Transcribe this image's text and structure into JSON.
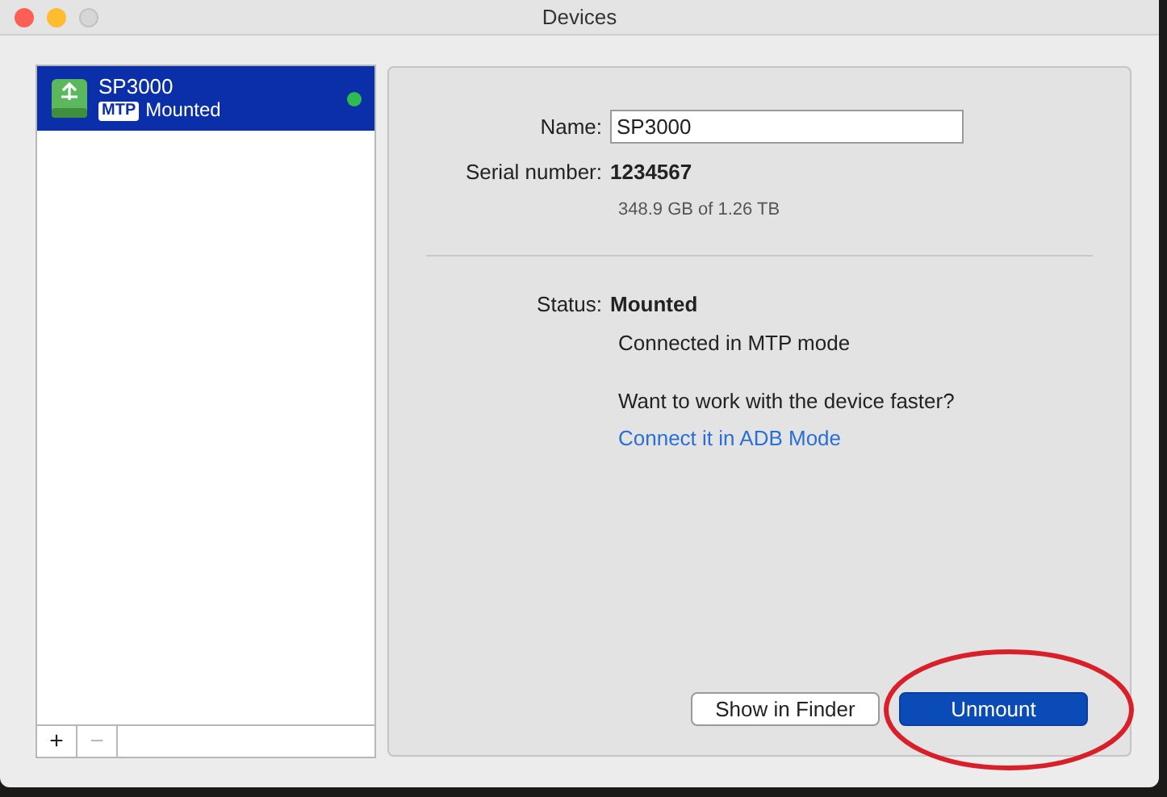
{
  "window": {
    "title": "Devices"
  },
  "devices": [
    {
      "name": "SP3000",
      "mode": "MTP",
      "status": "Mounted",
      "selected": true,
      "color": "#2dbd4e"
    }
  ],
  "list_buttons": [
    {
      "label": "+",
      "disabled": false
    },
    {
      "label": "−",
      "disabled": true
    }
  ],
  "details": {
    "name_label": "Name:",
    "name_value": "SP3000",
    "serial_label": "Serial number:",
    "serial_value": "1234567",
    "capacity": "348.9 GB of 1.26 TB",
    "status_label": "Status:",
    "status_value": "Mounted",
    "status_detail": "Connected in MTP mode",
    "hint": "Want to work with the device faster?",
    "link": "Connect it in ADB Mode"
  },
  "buttons": [
    {
      "label": "Show in Finder",
      "kind": "secondary"
    },
    {
      "label": "Unmount",
      "kind": "primary"
    }
  ],
  "annotation": {
    "kind": "ellipse",
    "color": "#d9202a"
  }
}
